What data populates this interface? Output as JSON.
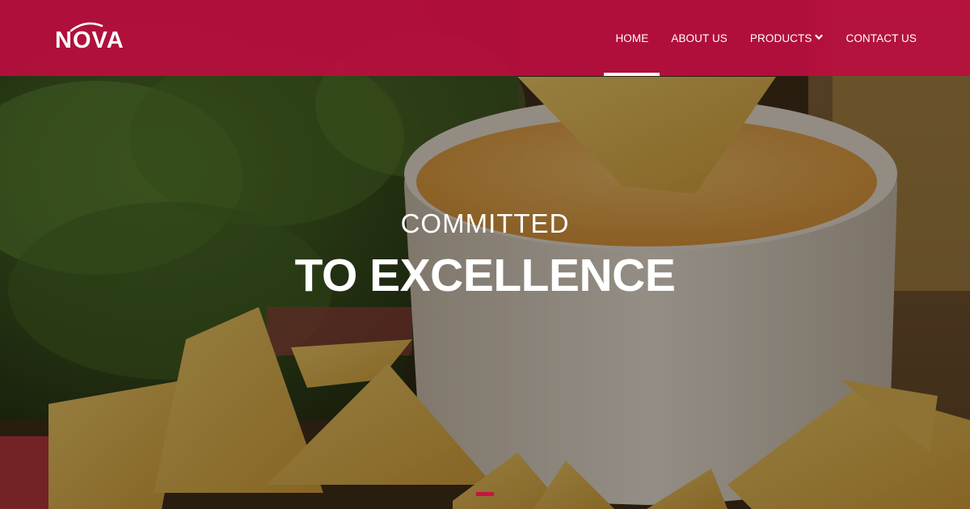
{
  "brand": {
    "logo_text": "NOVA",
    "primary_color": "#ba0e3e"
  },
  "nav": {
    "items": [
      {
        "label": "HOME",
        "active": true
      },
      {
        "label": "ABOUT US",
        "active": false
      },
      {
        "label": "PRODUCTS",
        "active": false,
        "has_dropdown": true,
        "icon": "chevron-down-icon"
      },
      {
        "label": "CONTACT US",
        "active": false
      }
    ]
  },
  "hero": {
    "line1": "COMMITTED",
    "line2": "TO EXCELLENCE",
    "background": "tortilla chips with cheese dip"
  }
}
